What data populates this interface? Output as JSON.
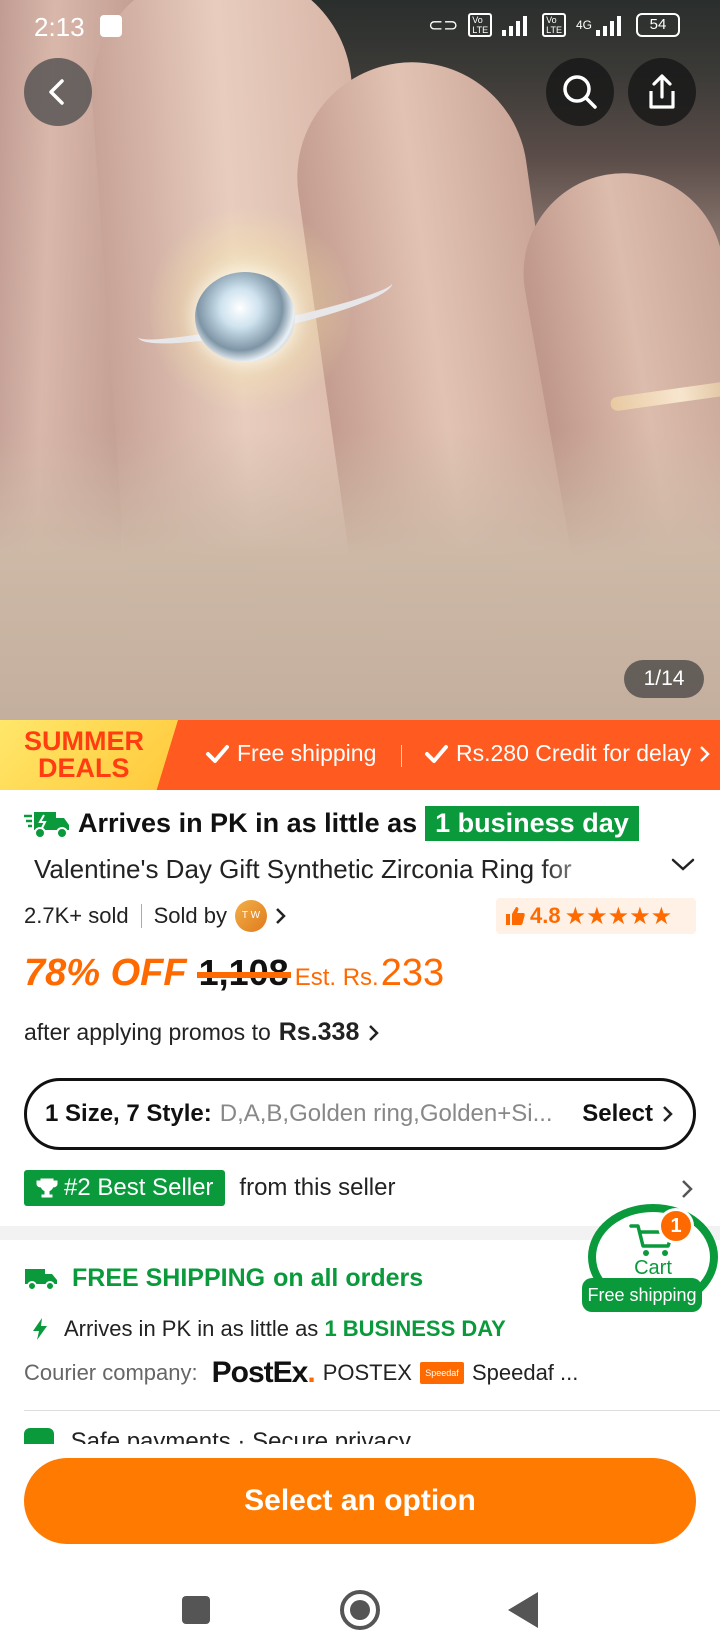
{
  "status_bar": {
    "time": "2:13",
    "network": "4G",
    "battery": "54"
  },
  "gallery": {
    "counter": "1/14"
  },
  "banner": {
    "summer_line1": "SUMMER",
    "summer_line2": "DEALS",
    "item1": "Free shipping",
    "item2": "Rs.280 Credit for delay"
  },
  "arrival": {
    "text": "Arrives in PK in as little as",
    "highlight": "1 business day"
  },
  "product": {
    "title": "Valentine's Day Gift Synthetic Zirconia Ring for",
    "sold": "2.7K+ sold",
    "sold_by": "Sold by",
    "seller_avatar": "T W",
    "rating": "4.8",
    "stars": "★★★★★"
  },
  "price": {
    "discount": "78% OFF",
    "original": "1,108",
    "est_label": "Est. Rs.",
    "est_value": "233",
    "promo_text": "after applying promos to",
    "promo_value": "Rs.338"
  },
  "options": {
    "label": "1 Size, 7 Style:",
    "values": "D,A,B,Golden ring,Golden+Si...",
    "select": "Select"
  },
  "best_seller": {
    "badge": "#2 Best Seller",
    "text": "from this seller"
  },
  "shipping": {
    "free_bold": "FREE SHIPPING",
    "free_rest": "on all orders",
    "arrive_text": "Arrives in PK in as little as",
    "arrive_bold": "1 BUSINESS DAY",
    "courier_label": "Courier company:",
    "courier1_logo": "PostEx",
    "courier1": "POSTEX",
    "courier2_logo": "Speedaf",
    "courier2": "Speedaf ...",
    "next_row": "Safe payments · Secure privacy"
  },
  "cart": {
    "label": "Cart",
    "badge": "1",
    "free": "Free shipping"
  },
  "cta": {
    "label": "Select an option"
  },
  "colors": {
    "orange": "#ff6a00",
    "green": "#0a9a3c"
  }
}
